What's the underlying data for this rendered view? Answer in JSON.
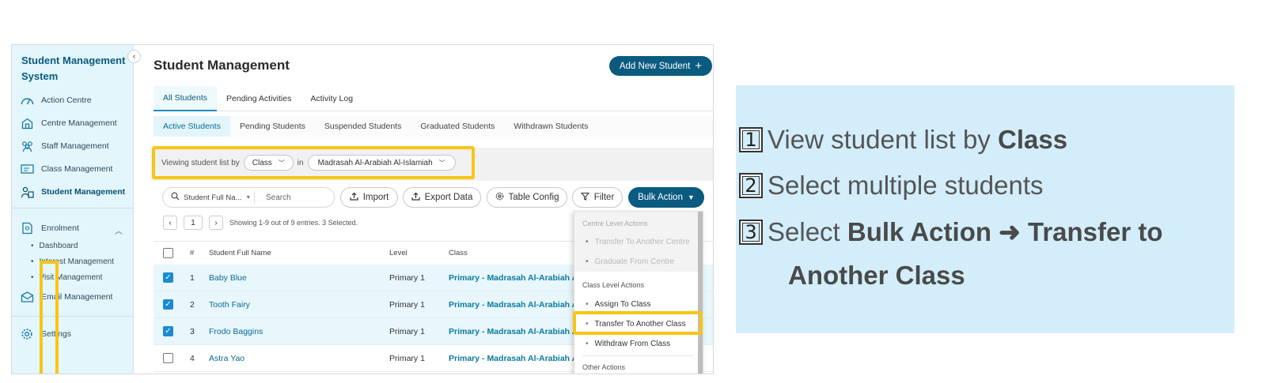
{
  "sidebar": {
    "brand": "Student Management System",
    "items": [
      {
        "label": "Action Centre",
        "icon": "speedometer-icon"
      },
      {
        "label": "Centre Management",
        "icon": "building-icon"
      },
      {
        "label": "Staff Management",
        "icon": "people-group-icon"
      },
      {
        "label": "Class Management",
        "icon": "classroom-board-icon"
      },
      {
        "label": "Student Management",
        "icon": "students-icon"
      },
      {
        "label": "Enrolment",
        "icon": "enrolment-icon"
      },
      {
        "label": "Email Management",
        "icon": "email-icon"
      },
      {
        "label": "Settings",
        "icon": "gear-icon"
      }
    ],
    "enrolment_sub": [
      "Dashboard",
      "Interest Management",
      "Visit Management"
    ]
  },
  "main": {
    "title": "Student Management",
    "add_button": "Add New Student",
    "tabs": [
      "All Students",
      "Pending Activities",
      "Activity Log"
    ],
    "subtabs": [
      "Active Students",
      "Pending Students",
      "Suspended Students",
      "Graduated Students",
      "Withdrawn Students"
    ],
    "view_bar": {
      "prefix": "Viewing student list by",
      "by_value": "Class",
      "in_text": "in",
      "centre_value": "Madrasah Al-Arabiah Al-Islamiah"
    },
    "toolbar": {
      "search_field": "Student Full Na...",
      "search_placeholder": "Search",
      "import": "Import",
      "export": "Export Data",
      "table_config": "Table Config",
      "filter": "Filter",
      "bulk_action": "Bulk Action"
    },
    "pager": {
      "current_page": "1",
      "summary": "Showing 1-9 out of 9 entries. 3 Selected."
    },
    "table": {
      "columns": [
        "#",
        "Student Full Name",
        "Level",
        "Class"
      ],
      "rows": [
        {
          "num": "1",
          "name": "Baby Blue",
          "level": "Primary 1",
          "class": "Primary - Madrasah Al-Arabiah Al-I",
          "checked": true
        },
        {
          "num": "2",
          "name": "Tooth Fairy",
          "level": "Primary 1",
          "class": "Primary - Madrasah Al-Arabiah Al-I",
          "checked": true
        },
        {
          "num": "3",
          "name": "Frodo Baggins",
          "level": "Primary 1",
          "class": "Primary - Madrasah Al-Arabiah Al-I",
          "checked": true
        },
        {
          "num": "4",
          "name": "Astra Yao",
          "level": "Primary 1",
          "class": "Primary - Madrasah Al-Arabiah Al-I",
          "checked": false
        }
      ]
    },
    "dropdown": {
      "centre_section": "Centre Level Actions",
      "centre_items": [
        "Transfer To Another Centre",
        "Graduate From Centre"
      ],
      "class_section": "Class Level Actions",
      "class_items": [
        "Assign To Class",
        "Transfer To Another Class",
        "Withdraw From Class"
      ],
      "other_section": "Other Actions"
    }
  },
  "instructions": {
    "step1": {
      "num": "1",
      "text": "View student list by ",
      "bold": "Class"
    },
    "step2": {
      "num": "2",
      "text": "Select multiple students"
    },
    "step3": {
      "num": "3",
      "text": "Select ",
      "bold": "Bulk Action ➜ Transfer to",
      "cont": "Another Class"
    }
  },
  "colors": {
    "primary": "#0b5a80",
    "highlight": "#f7c515",
    "sidebar_bg": "#e2f6fb",
    "panel_bg": "#d3eefa"
  }
}
